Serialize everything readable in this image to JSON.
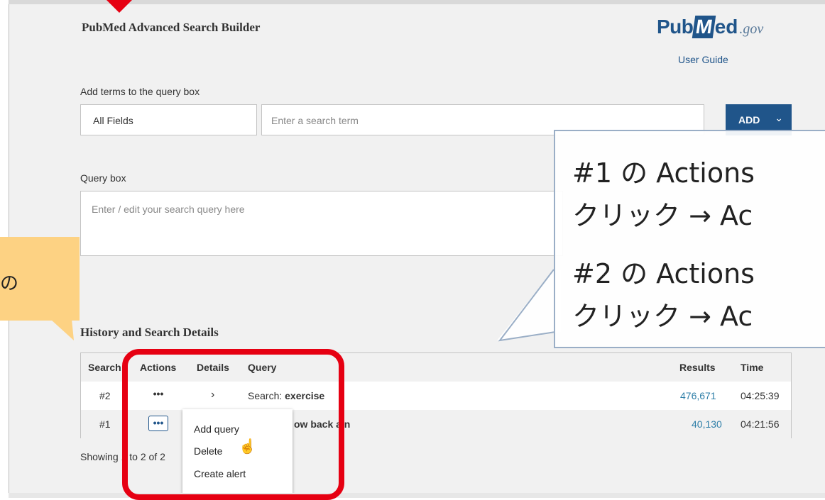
{
  "header": {
    "title": "PubMed Advanced Search Builder",
    "logo_pub": "Pub",
    "logo_med_m": "M",
    "logo_med_rest": "ed",
    "logo_gov": ".gov",
    "user_guide": "User Guide"
  },
  "builder": {
    "label": "Add terms to the query box",
    "field_value": "All Fields",
    "term_placeholder": "Enter a search term",
    "add_label": "ADD",
    "add_chevron": "⌄"
  },
  "query": {
    "label": "Query box",
    "placeholder": "Enter / edit your search query here"
  },
  "history": {
    "title": "History and Search Details",
    "columns": {
      "search": "Search",
      "actions": "Actions",
      "details": "Details",
      "query": "Query",
      "results": "Results",
      "time": "Time"
    },
    "rows": [
      {
        "search": "#2",
        "actions": "•••",
        "details": "›",
        "query_prefix": "Search: ",
        "query_term": "exercise",
        "results": "476,671",
        "time": "04:25:39"
      },
      {
        "search": "#1",
        "actions": "•••",
        "details": "",
        "query_prefix": "",
        "query_term": "ow back ain",
        "results": "40,130",
        "time": "04:21:56"
      }
    ],
    "showing": "Showing 1 to 2 of 2"
  },
  "actions_menu": {
    "items": [
      "Add query",
      "Delete",
      "Create alert"
    ]
  },
  "annotations": {
    "right_line1": "#1 の Actions",
    "right_line2": "クリック → Ac",
    "right_line3": "#2 の Actions",
    "right_line4": "クリック → Ac",
    "left_text": "の"
  },
  "colors": {
    "brand": "#20558a",
    "highlight_red": "#e60012",
    "callout_yellow": "#fdd283",
    "link": "#2f7fa8"
  },
  "icons": {
    "cursor": "hand-pointer-icon",
    "chevron": "chevron-right-icon",
    "more": "more-dots-icon"
  }
}
